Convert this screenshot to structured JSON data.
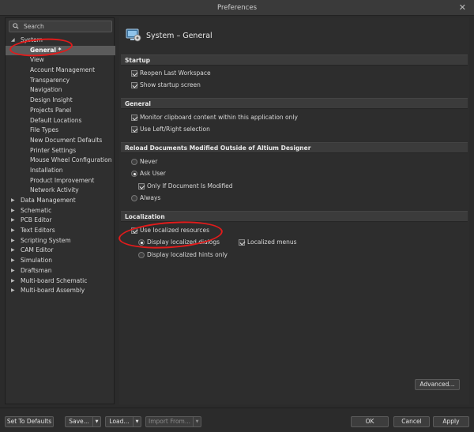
{
  "window": {
    "title": "Preferences",
    "close_glyph": "✕"
  },
  "search": {
    "placeholder": "Search"
  },
  "tree": [
    {
      "label": "System",
      "expanded": true,
      "children": [
        "General *",
        "View",
        "Account Management",
        "Transparency",
        "Navigation",
        "Design Insight",
        "Projects Panel",
        "Default Locations",
        "File Types",
        "New Document Defaults",
        "Printer Settings",
        "Mouse Wheel Configuration",
        "Installation",
        "Product Improvement",
        "Network Activity"
      ]
    },
    {
      "label": "Data Management"
    },
    {
      "label": "Schematic"
    },
    {
      "label": "PCB Editor"
    },
    {
      "label": "Text Editors"
    },
    {
      "label": "Scripting System"
    },
    {
      "label": "CAM Editor"
    },
    {
      "label": "Simulation"
    },
    {
      "label": "Draftsman"
    },
    {
      "label": "Multi-board Schematic"
    },
    {
      "label": "Multi-board Assembly"
    }
  ],
  "tree_selected": "General *",
  "page": {
    "title": "System – General",
    "icon": "monitor-settings-icon"
  },
  "sections": {
    "startup": {
      "title": "Startup",
      "options": [
        {
          "label": "Reopen Last Workspace",
          "checked": true
        },
        {
          "label": "Show startup screen",
          "checked": true
        }
      ]
    },
    "general": {
      "title": "General",
      "options": [
        {
          "label": "Monitor clipboard content within this application only",
          "checked": true
        },
        {
          "label": "Use Left/Right selection",
          "checked": true
        }
      ]
    },
    "reload": {
      "title": "Reload Documents Modified Outside of Altium Designer",
      "never": {
        "label": "Never",
        "selected": false
      },
      "ask": {
        "label": "Ask User",
        "selected": true
      },
      "only_if": {
        "label": "Only If Document Is Modified",
        "checked": true
      },
      "always": {
        "label": "Always",
        "selected": false
      }
    },
    "localization": {
      "title": "Localization",
      "use_localized": {
        "label": "Use localized resources",
        "checked": true
      },
      "dialogs": {
        "label": "Display localized dialogs",
        "selected": true
      },
      "menus": {
        "label": "Localized menus",
        "checked": true
      },
      "hints": {
        "label": "Display localized hints only",
        "selected": false
      }
    }
  },
  "buttons": {
    "advanced": "Advanced...",
    "set_defaults": "Set To Defaults",
    "save": "Save...",
    "load": "Load...",
    "import_from": "Import From...",
    "ok": "OK",
    "cancel": "Cancel",
    "apply": "Apply"
  },
  "colors": {
    "background": "#2b2b2b",
    "section": "#3b3b3b",
    "selection": "#5b5b5b",
    "annotation": "#e21b1b"
  }
}
